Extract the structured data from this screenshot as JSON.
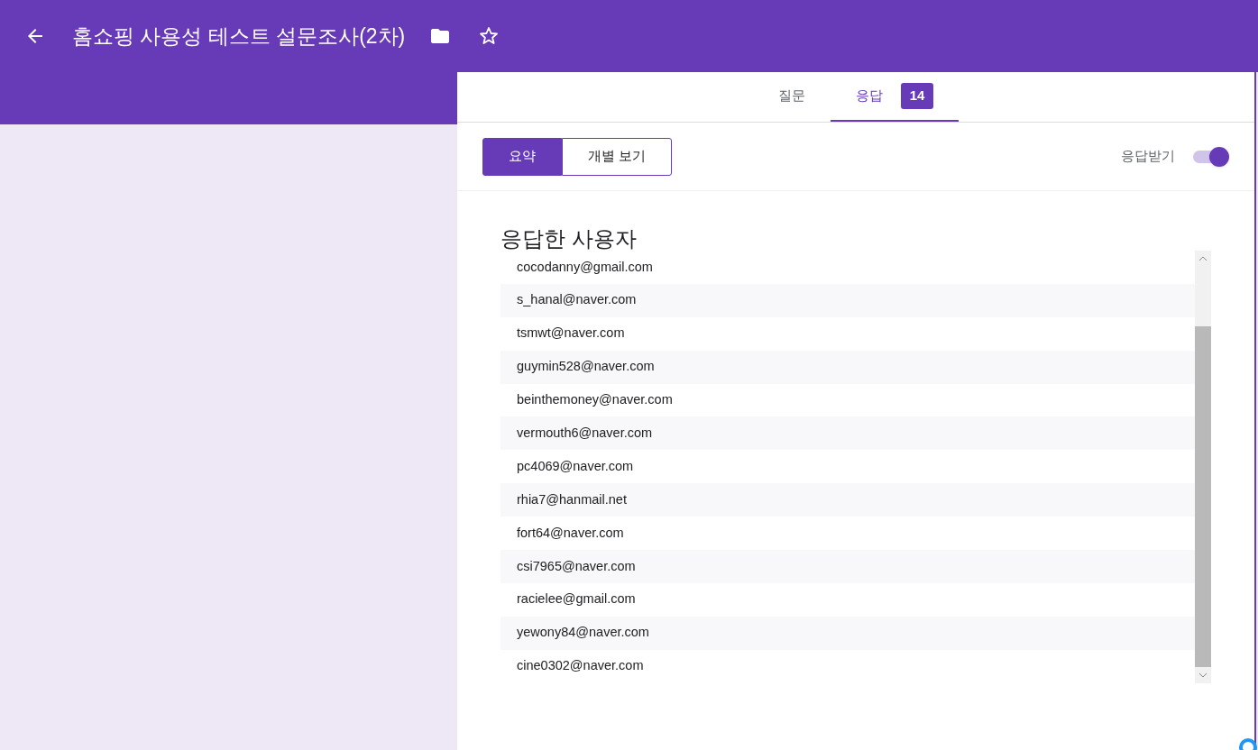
{
  "header": {
    "title": "홈쇼핑 사용성 테스트 설문조사(2차)"
  },
  "tabs": [
    {
      "label": "질문",
      "selected": false
    },
    {
      "label": "응답",
      "selected": true,
      "count": "14"
    }
  ],
  "view_toggle": [
    {
      "label": "요약",
      "selected": true
    },
    {
      "label": "개별 보기",
      "selected": false
    }
  ],
  "accepting_responses": {
    "label": "응답받기",
    "on": true
  },
  "respondents": {
    "title": "응답한 사용자",
    "emails": [
      "cocodanny@gmail.com",
      "s_hanal@naver.com",
      "tsmwt@naver.com",
      "guymin528@naver.com",
      "beinthemoney@naver.com",
      "vermouth6@naver.com",
      "pc4069@naver.com",
      "rhia7@hanmail.net",
      "fort64@naver.com",
      "csi7965@naver.com",
      "racielee@gmail.com",
      "yewony84@naver.com",
      "cine0302@naver.com"
    ]
  }
}
